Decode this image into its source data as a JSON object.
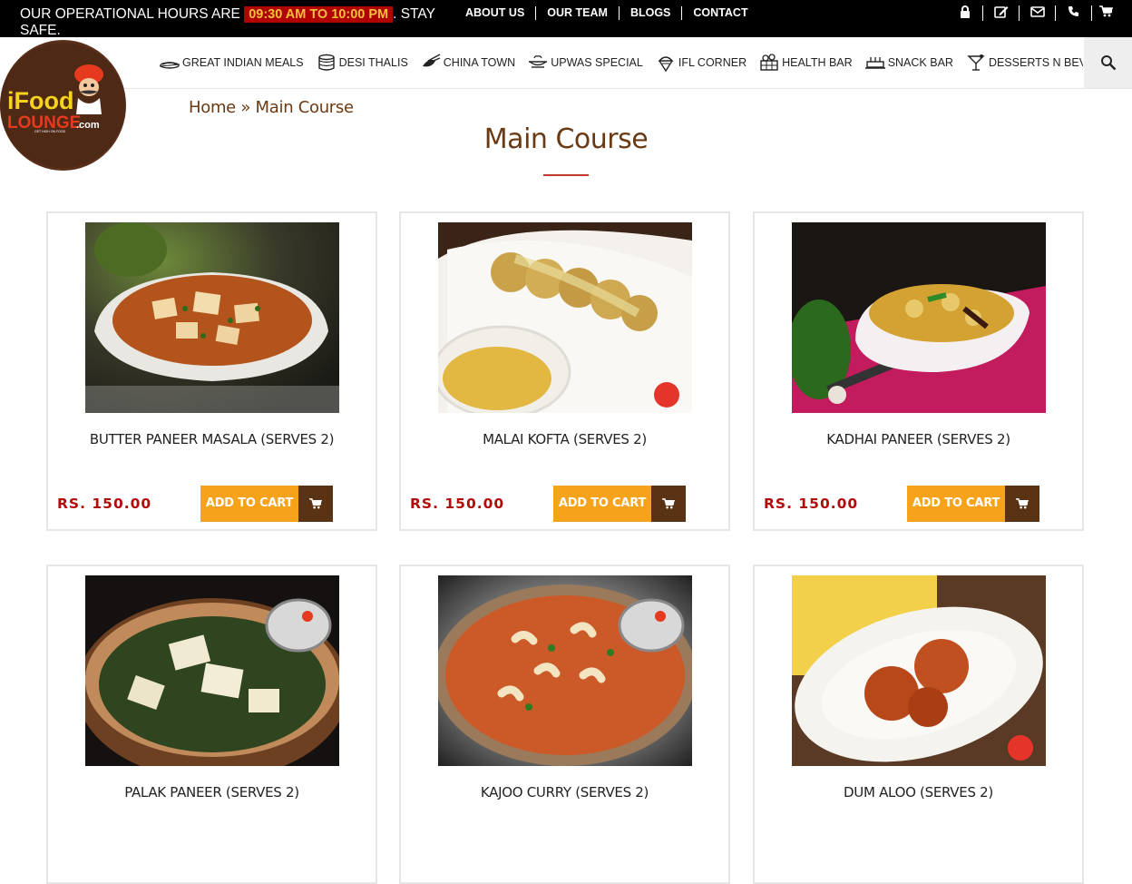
{
  "topbar": {
    "hours_prefix": "OUR OPERATIONAL HOURS ARE ",
    "hours_highlight": "09:30 AM TO 10:00 PM",
    "hours_suffix": ". STAY SAFE.",
    "links": [
      "ABOUT US",
      "OUR TEAM",
      "BLOGS",
      "CONTACT"
    ],
    "icons": [
      "lock-icon",
      "edit-icon",
      "envelope-icon",
      "phone-icon",
      "cart-icon"
    ]
  },
  "menu": {
    "items": [
      {
        "label": "GREAT INDIAN MEALS",
        "icon": "dish-icon"
      },
      {
        "label": "DESI THALIS",
        "icon": "thali-icon"
      },
      {
        "label": "CHINA TOWN",
        "icon": "chopsticks-icon"
      },
      {
        "label": "UPWAS SPECIAL",
        "icon": "bowl-icon"
      },
      {
        "label": "IFL CORNER",
        "icon": "ice-cream-icon"
      },
      {
        "label": "HEALTH BAR",
        "icon": "fruit-basket-icon"
      },
      {
        "label": "SNACK BAR",
        "icon": "cake-icon"
      },
      {
        "label": "DESSERTS N BEVERAGES",
        "icon": "cocktail-icon"
      }
    ],
    "search_icon": "search-icon"
  },
  "logo": {
    "text_top": "iFood",
    "text_bottom": "LOUNGE",
    "text_com": ".com",
    "tagline": "GET HIGH ON FOOD"
  },
  "breadcrumb": {
    "home": "Home",
    "separator": " » ",
    "current": "Main Course"
  },
  "page_title": "Main Course",
  "products": [
    {
      "name": "BUTTER PANEER MASALA (SERVES 2)",
      "price": "RS. 150.00",
      "button": "ADD TO CART"
    },
    {
      "name": "MALAI KOFTA (SERVES 2)",
      "price": "RS. 150.00",
      "button": "ADD TO CART"
    },
    {
      "name": "KADHAI PANEER (SERVES 2)",
      "price": "RS. 150.00",
      "button": "ADD TO CART"
    },
    {
      "name": "PALAK PANEER (SERVES 2)",
      "price": "",
      "button": ""
    },
    {
      "name": "KAJOO CURRY (SERVES 2)",
      "price": "",
      "button": ""
    },
    {
      "name": "DUM ALOO (SERVES 2)",
      "price": "",
      "button": ""
    }
  ],
  "colors": {
    "topbar_bg": "#000000",
    "highlight_bg": "#b00000",
    "highlight_text": "#f3c23a",
    "brand_brown": "#6a3a14",
    "price_red": "#b10c0c",
    "button_orange": "#f7a21b",
    "button_icon_bg": "#5a3214"
  }
}
